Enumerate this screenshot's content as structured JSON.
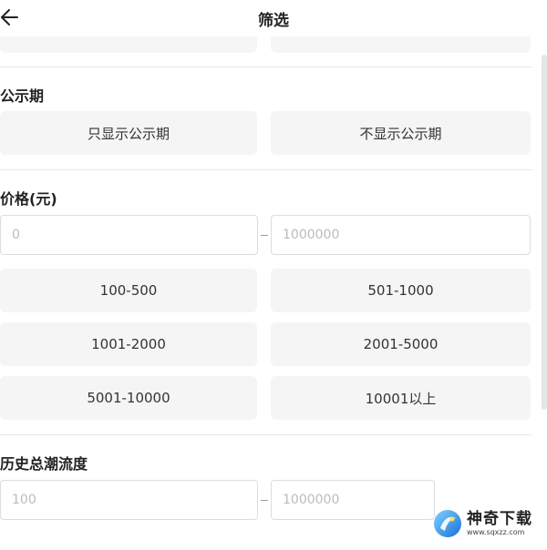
{
  "header": {
    "title": "筛选",
    "back_icon": "arrow-left-icon"
  },
  "notice_period": {
    "title": "公示期",
    "options": [
      "只显示公示期",
      "不显示公示期"
    ]
  },
  "price": {
    "title": "价格(元)",
    "min_placeholder": "0",
    "max_placeholder": "1000000",
    "ranges": [
      "100-500",
      "501-1000",
      "1001-2000",
      "2001-5000",
      "5001-10000",
      "10001以上"
    ]
  },
  "history_popularity": {
    "title": "历史总潮流度",
    "min_placeholder": "100",
    "max_placeholder": "1000000"
  },
  "watermark": {
    "name": "神奇下载",
    "url": "www.sqxzz.com"
  }
}
